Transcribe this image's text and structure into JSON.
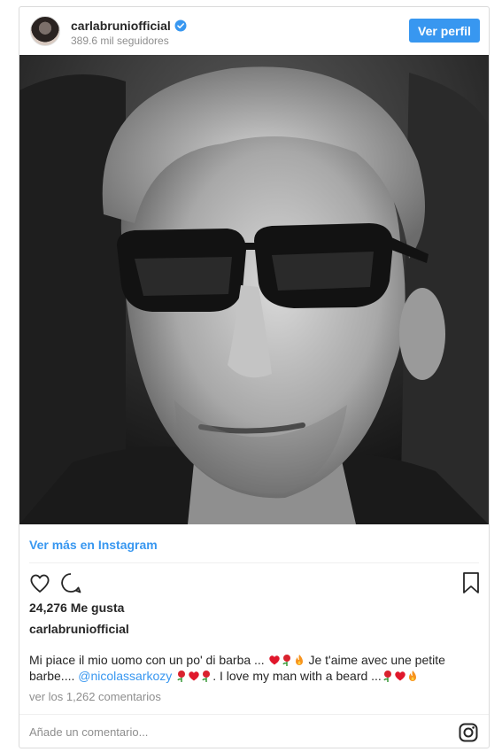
{
  "header": {
    "username": "carlabrunіofficial",
    "followers": "389.6 mil seguidores",
    "view_profile_label": "Ver perfil"
  },
  "post": {
    "view_more_label": "Ver más en Instagram",
    "likes": "24,276 Me gusta",
    "author": "carlabrunіofficial",
    "caption_part1": "Mi piace il mio uomo con un po' di barba ... ",
    "caption_part2": " Je t'aime avec une petite barbe.... ",
    "mention": "@nicolassarkozy",
    "caption_part3": ". I love my man with a beard ...",
    "comments_link": "ver los 1,262 comentarios"
  },
  "comment_box": {
    "placeholder": "Añade un comentario..."
  },
  "colors": {
    "accent": "#3897f0",
    "text": "#262626",
    "muted": "#8e8e8e",
    "border": "#dbdbdb"
  },
  "icons": [
    "verified-badge-icon",
    "heart-icon",
    "comment-icon",
    "bookmark-icon",
    "rose-icon",
    "red-heart-icon",
    "fire-icon",
    "instagram-icon"
  ]
}
